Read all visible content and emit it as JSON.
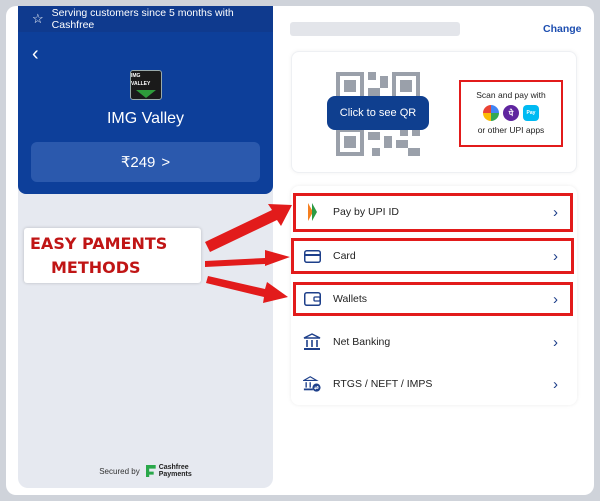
{
  "banner": {
    "text": "Serving customers since 5 months with Cashfree"
  },
  "merchant": {
    "logo_text": "IMG VALLEY",
    "name": "IMG Valley",
    "amount": "₹249",
    "amount_chevron": ">"
  },
  "footer": {
    "secured_by": "Secured by",
    "brand_line1": "Cashfree",
    "brand_line2": "Payments"
  },
  "header": {
    "change_label": "Change"
  },
  "qr": {
    "button_label": "Click to see QR"
  },
  "upi": {
    "line1": "Scan and pay with",
    "line2": "or other UPI apps",
    "apps": [
      "gpay-icon",
      "phonepe-icon",
      "paytm-icon"
    ]
  },
  "methods": [
    {
      "label": "Pay by UPI ID",
      "icon": "upi-icon"
    },
    {
      "label": "Card",
      "icon": "card-icon"
    },
    {
      "label": "Wallets",
      "icon": "wallet-icon"
    },
    {
      "label": "Net Banking",
      "icon": "bank-icon"
    },
    {
      "label": "RTGS / NEFT / IMPS",
      "icon": "bank-transfer-icon"
    }
  ],
  "annotation": {
    "line1": "EASY PAMENTS",
    "line2": "METHODS"
  },
  "colors": {
    "brand": "#0d3f9a",
    "highlight": "#e21b1b",
    "annotation": "#c01515"
  }
}
